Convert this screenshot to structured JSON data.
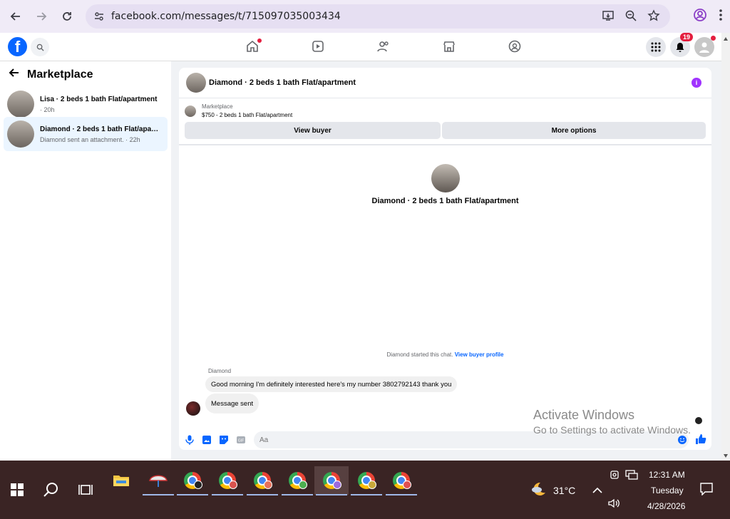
{
  "browser": {
    "url": "facebook.com/messages/t/715097035003434"
  },
  "fb_nav": {
    "notifications_count": "19"
  },
  "left_pane": {
    "title": "Marketplace",
    "conversations": [
      {
        "name": "Lisa · 2 beds 1 bath Flat/apartment",
        "sub": "· 20h",
        "active": false
      },
      {
        "name": "Diamond · 2 beds 1 bath Flat/apartment",
        "sub": "Diamond sent an attachment. · 22h",
        "active": true
      }
    ]
  },
  "chat": {
    "header_title": "Diamond · 2 beds 1 bath Flat/apartment",
    "marketplace_label": "Marketplace",
    "listing": "$750 - 2 beds 1 bath Flat/apartment",
    "view_buyer_label": "View buyer",
    "more_options_label": "More options",
    "center_title": "Diamond · 2 beds 1 bath Flat/apartment",
    "started_text": "Diamond started this chat.",
    "view_buyer_profile": "View buyer profile",
    "sender_name": "Diamond",
    "messages": [
      "Good morning I'm definitely interested here's my number 3802792143 thank you",
      "Message sent"
    ],
    "composer_placeholder": "Aa"
  },
  "watermark": {
    "line1": "Activate Windows",
    "line2": "Go to Settings to activate Windows."
  },
  "taskbar": {
    "temperature": "31°C",
    "time": "12:31 AM",
    "day": "Tuesday",
    "date": "4/28/2026"
  },
  "colors": {
    "fb_blue": "#0866ff",
    "taskbar_bg": "#3a2424",
    "info_purple": "#a033ff"
  }
}
